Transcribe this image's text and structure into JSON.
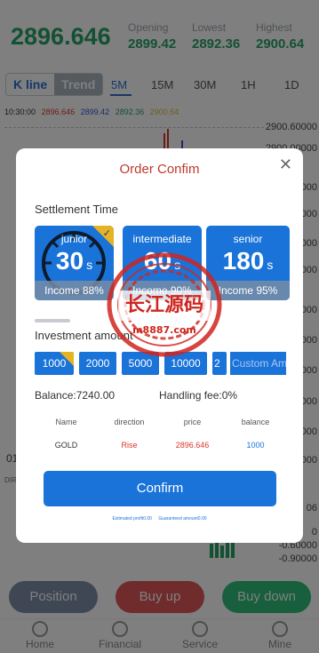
{
  "quote": {
    "price": "2896.646",
    "opening_label": "Opening",
    "opening_value": "2899.42",
    "lowest_label": "Lowest",
    "lowest_value": "2892.36",
    "highest_label": "Highest",
    "highest_value": "2900.64"
  },
  "chart_tabs": {
    "kline": "K line",
    "trend": "Trend"
  },
  "periods": [
    "5M",
    "15M",
    "30M",
    "1H",
    "1D"
  ],
  "ohlc": {
    "time": "10:30:00",
    "v1": "2896.646",
    "v2": "2899.42",
    "v3": "2892.36",
    "v4": "2900.64"
  },
  "y_axis": [
    "2900.60000",
    "2900.00000",
    "0000",
    "0000",
    "0000",
    "0000",
    "0000",
    "0000",
    "0000",
    "0000",
    "0000",
    "0000"
  ],
  "vol_axis": [
    "06",
    "0",
    "-0.60000",
    "-0.90000"
  ],
  "left_labels": {
    "t": "01",
    "dir": "DIR"
  },
  "actions": {
    "position": "Position",
    "buy_up": "Buy up",
    "buy_down": "Buy down"
  },
  "tabbar": [
    "Home",
    "Financial",
    "Service",
    "Mine"
  ],
  "modal": {
    "title": "Order Confim",
    "settlement_label": "Settlement Time",
    "cards": [
      {
        "name": "junior",
        "number": "30",
        "unit": "s",
        "income": "Income 88%"
      },
      {
        "name": "intermediate",
        "number": "60",
        "unit": "s",
        "income": "Income 90%"
      },
      {
        "name": "senior",
        "number": "180",
        "unit": "s",
        "income": "Income 95%"
      }
    ],
    "investment_label": "Investment amount",
    "amounts": [
      "1000",
      "2000",
      "5000",
      "10000",
      "2"
    ],
    "custom_placeholder": "Custom Amount",
    "balance": "Balance:7240.00",
    "fee": "Handling fee:0%",
    "table": {
      "headers": [
        "Name",
        "direction",
        "price",
        "balance"
      ],
      "row": [
        "GOLD",
        "Rise",
        "2896.646",
        "1000"
      ]
    },
    "confirm_label": "Confirm",
    "estimated": "Estimated profit0.00",
    "guaranteed": "Guaranteed amount0.00"
  },
  "watermark": {
    "cn": "长江源码",
    "url": "m8887.com"
  },
  "colors": {
    "green": "#26a269",
    "blue": "#1a73d9",
    "red": "#c0392b",
    "gold": "#e6b422"
  }
}
